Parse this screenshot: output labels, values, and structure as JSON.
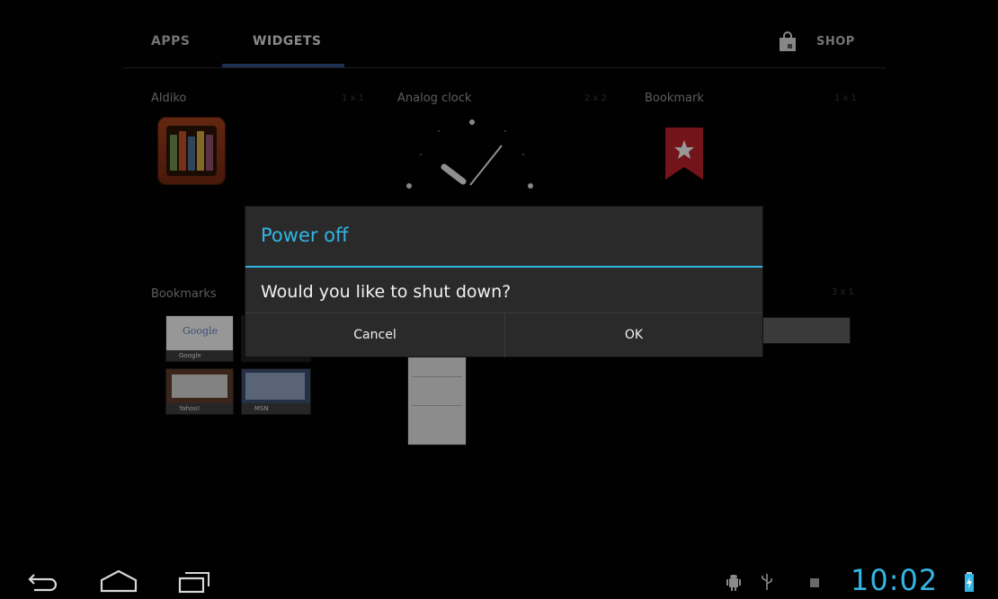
{
  "tabs": [
    {
      "label": "APPS"
    },
    {
      "label": "WIDGETS"
    }
  ],
  "shop": {
    "label": "SHOP"
  },
  "widgets": [
    {
      "name": "Aldiko",
      "size": "1 x 1"
    },
    {
      "name": "Analog clock",
      "size": "2 x 2"
    },
    {
      "name": "Bookmark",
      "size": "1 x 1"
    },
    {
      "name": "Bookmarks",
      "size": ""
    },
    {
      "name": "",
      "size": "3 x 1"
    }
  ],
  "bookmark_thumbs": [
    {
      "caption": "Google",
      "title": "Google"
    },
    {
      "caption": "Yahoo!"
    },
    {
      "caption": "MSN"
    }
  ],
  "dialog": {
    "title": "Power off",
    "message": "Would you like to shut down?",
    "cancel": "Cancel",
    "ok": "OK"
  },
  "statusbar": {
    "time": "10:02"
  },
  "colors": {
    "accent": "#33b5e5",
    "dialog_bg": "#2a2a2a",
    "background": "#020202"
  },
  "icons": [
    "back-icon",
    "home-icon",
    "recent-apps-icon",
    "android-debug-icon",
    "usb-icon",
    "sd-card-icon",
    "battery-icon",
    "shopping-bag-icon"
  ]
}
